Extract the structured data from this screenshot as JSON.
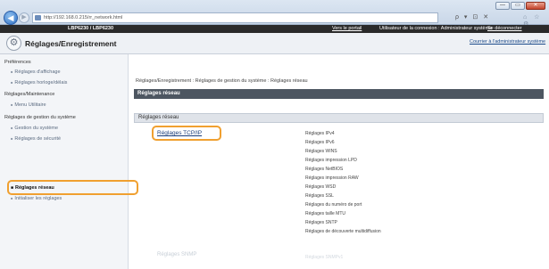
{
  "browser": {
    "url": "http://192.168.0.215/rr_network.html",
    "tools": "ρ ▾ ⊡ ✕",
    "tab_icons": "⌂ ☆ ⚙",
    "window_controls": [
      "—",
      "▭",
      "✕"
    ]
  },
  "header": {
    "printer_name": "LBP6230 / LBP6230",
    "portal_link": "Vers le portail",
    "user_info": "Utilisateur de la connexion : Administrateur système",
    "logout_link": "Se déconnecter"
  },
  "title": {
    "text": "Réglages/Enregistrement",
    "mail_link": "Courrier à l'administrateur système"
  },
  "sidebar": {
    "groups": [
      {
        "label": "Préférences",
        "items": [
          "Réglages d'affichage",
          "Réglages horloge/délais"
        ]
      },
      {
        "label": "Réglages/Maintenance",
        "items": [
          "Menu Utilitaire"
        ]
      },
      {
        "label": "Réglages de gestion du système",
        "items": [
          "Gestion du système",
          "Réglages de sécurité",
          "Réglages réseau",
          "Initialiser les réglages"
        ]
      }
    ],
    "active_item": "Réglages réseau"
  },
  "main": {
    "breadcrumb": "Réglages/Enregistrement : Réglages de gestion du système : Réglages réseau",
    "section_title": "Réglages réseau",
    "subsection_title": "Réglages réseau",
    "tcp_link": "Réglages TCP/IP",
    "tcp_items": [
      "Réglages IPv4",
      "Réglages IPv6",
      "Réglages WINS",
      "Réglages impression LPD",
      "Réglages NetBIOS",
      "Réglages impression RAW",
      "Réglages WSD",
      "Réglages SSL",
      "Réglages du numéro de port",
      "Réglages taille MTU",
      "Réglages SNTP",
      "Réglages de découverte multidiffusion"
    ],
    "snmp_link": "Réglages SNMP",
    "snmp_item": "Réglages SNMPv1"
  },
  "colors": {
    "highlight": "#f0a030",
    "section_bar": "#4d5661",
    "topbar": "#2a2a2a"
  }
}
